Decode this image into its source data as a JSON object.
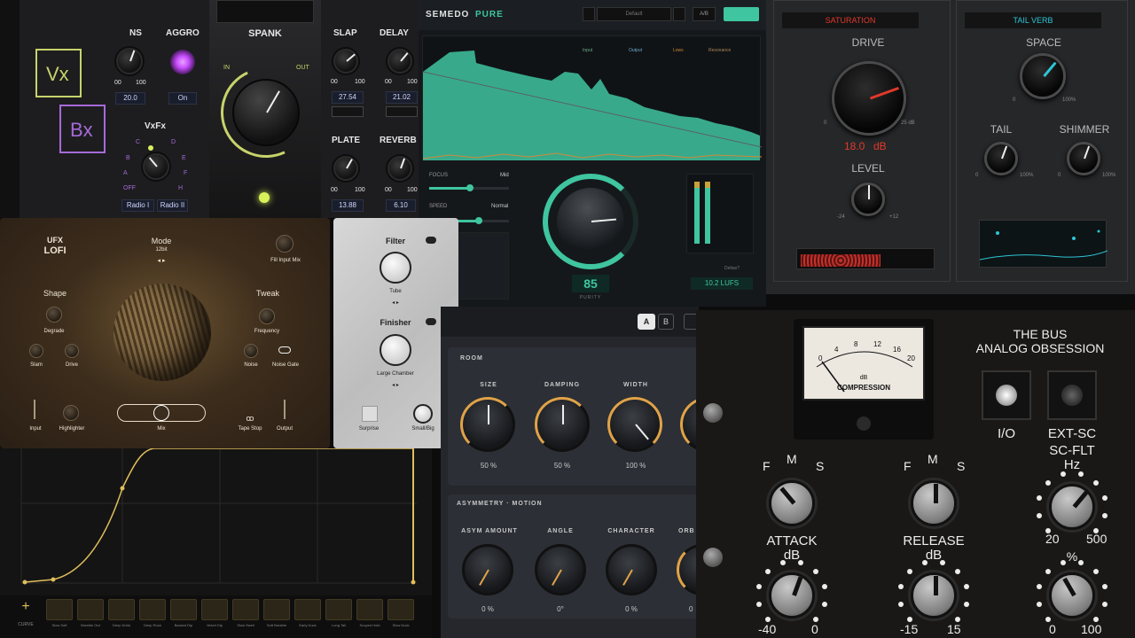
{
  "vx": {
    "logo_vx": "Vx",
    "logo_bx": "Bx",
    "ns_label": "NS",
    "ns_min": "00",
    "ns_max": "100",
    "ns_value": "20.0",
    "aggro_label": "AGGRO",
    "aggro_value": "On",
    "vxfx_label": "VxFx",
    "vxfx_positions": [
      "C",
      "D",
      "B",
      "E",
      "A",
      "F",
      "OFF",
      "H"
    ],
    "radio1": "Radio I",
    "radio2": "Radio II",
    "spank_label": "SPANK",
    "in_label": "IN",
    "out_label": "OUT",
    "slap_label": "SLAP",
    "slap_min": "00",
    "slap_max": "100",
    "slap_value": "27.54",
    "delay_label": "DELAY",
    "delay_min": "00",
    "delay_max": "100",
    "delay_value": "21.02",
    "plate_label": "PLATE",
    "plate_min": "00",
    "plate_max": "100",
    "plate_value": "13.88",
    "reverb_label": "REVERB",
    "reverb_min": "00",
    "reverb_max": "100",
    "reverb_value": "6.10",
    "accent": "#b9c46b",
    "aggro_color": "#c84cff"
  },
  "semedo": {
    "brand": "SEMEDO",
    "product": "PURE",
    "preset": "Default",
    "ab": "A/B",
    "legend": [
      "Input",
      "Output",
      "Lows",
      "Resonance"
    ],
    "focus_label": "FOCUS",
    "focus_value": "Mid",
    "speed_label": "SPEED",
    "speed_value": "Normal",
    "purity_value": "85",
    "purity_label": "PURITY",
    "deltas_label": "Deltas?",
    "readout": "10.2 LUFS",
    "accent": "#3fc5a0"
  },
  "sat": {
    "saturation_header": "SATURATION",
    "drive_label": "DRIVE",
    "drive_min": "0",
    "drive_max": "25 dB",
    "drive_value": "18.0",
    "drive_unit": "dB",
    "level_label": "LEVEL",
    "level_min": "-24",
    "level_max": "+12",
    "tailverb_header": "TAIL VERB",
    "space_label": "SPACE",
    "space_min": "0",
    "space_max": "100%",
    "tail_label": "TAIL",
    "tail_min": "0",
    "tail_max": "100%",
    "shimmer_label": "SHIMMER",
    "shimmer_min": "0",
    "shimmer_max": "100%",
    "sat_color": "#e2392b",
    "verb_color": "#2ec5d6"
  },
  "lofi": {
    "brand": "UFX",
    "title": "LOFI",
    "mode_label": "Mode",
    "mode_value": "12bit",
    "fill_label": "Fill Input Mix",
    "shape_label": "Shape",
    "degrade_label": "Degrade",
    "slam_label": "Slam",
    "drive_label": "Drive",
    "tweak_label": "Tweak",
    "frequency_label": "Frequency",
    "noise_label": "Noise",
    "noise_gate_label": "Noise Gate",
    "input_label": "Input",
    "highlighter_label": "Highlighter",
    "mix_label": "Mix",
    "tape_stop_label": "Tape Stop",
    "output_label": "Output"
  },
  "filter": {
    "filter_label": "Filter",
    "tube_label": "Tube",
    "finisher_label": "Finisher",
    "chamber_label": "Large Chamber",
    "surprise_label": "Surprise",
    "smallbig_label": "Small/Big"
  },
  "curve": {
    "add_label": "+",
    "curve_label": "CURVE",
    "shapes": [
      "Slow Soft",
      "Breathe Out",
      "Deep Drink",
      "Deep Rock",
      "Backed Dip",
      "Velvet Dip",
      "Slow Swell",
      "Soft Breathe",
      "Early Duck",
      "Long Tail",
      "Scoped Hold",
      "Slow Duck"
    ]
  },
  "reverb": {
    "tab_a": "A",
    "tab_b": "B",
    "room_header": "ROOM",
    "size_label": "SIZE",
    "size_value": "50 %",
    "damping_label": "DAMPING",
    "damping_value": "50 %",
    "width_label": "WIDTH",
    "width_value": "100 %",
    "asym_header": "ASYMMETRY · MOTION",
    "asym_label": "ASYM AMOUNT",
    "asym_value": "0 %",
    "angle_label": "ANGLE",
    "angle_value": "0°",
    "character_label": "CHARACTER",
    "character_value": "0 %",
    "orbit_label": "ORB",
    "orbit_value": "0",
    "accent": "#e0a348"
  },
  "bus": {
    "title1": "THE BUS",
    "title2": "ANALOG OBSESSION",
    "meter_scale": [
      "0",
      "4",
      "8",
      "12",
      "16",
      "20"
    ],
    "meter_db": "dB",
    "meter_label": "COMPRESSION",
    "io_label": "I/O",
    "extsc_label": "EXT-SC",
    "scflt_label": "SC-FLT",
    "hz_label": "Hz",
    "hz_min": "20",
    "hz_max": "500",
    "fms_f": "F",
    "fms_m": "M",
    "fms_s": "S",
    "attack_label": "ATTACK",
    "release_label": "RELEASE",
    "db_label": "dB",
    "pct_label": "%",
    "attack_min": "-40",
    "attack_max": "0",
    "release_min": "-15",
    "release_max": "15",
    "mix_min": "0",
    "mix_max": "100"
  }
}
